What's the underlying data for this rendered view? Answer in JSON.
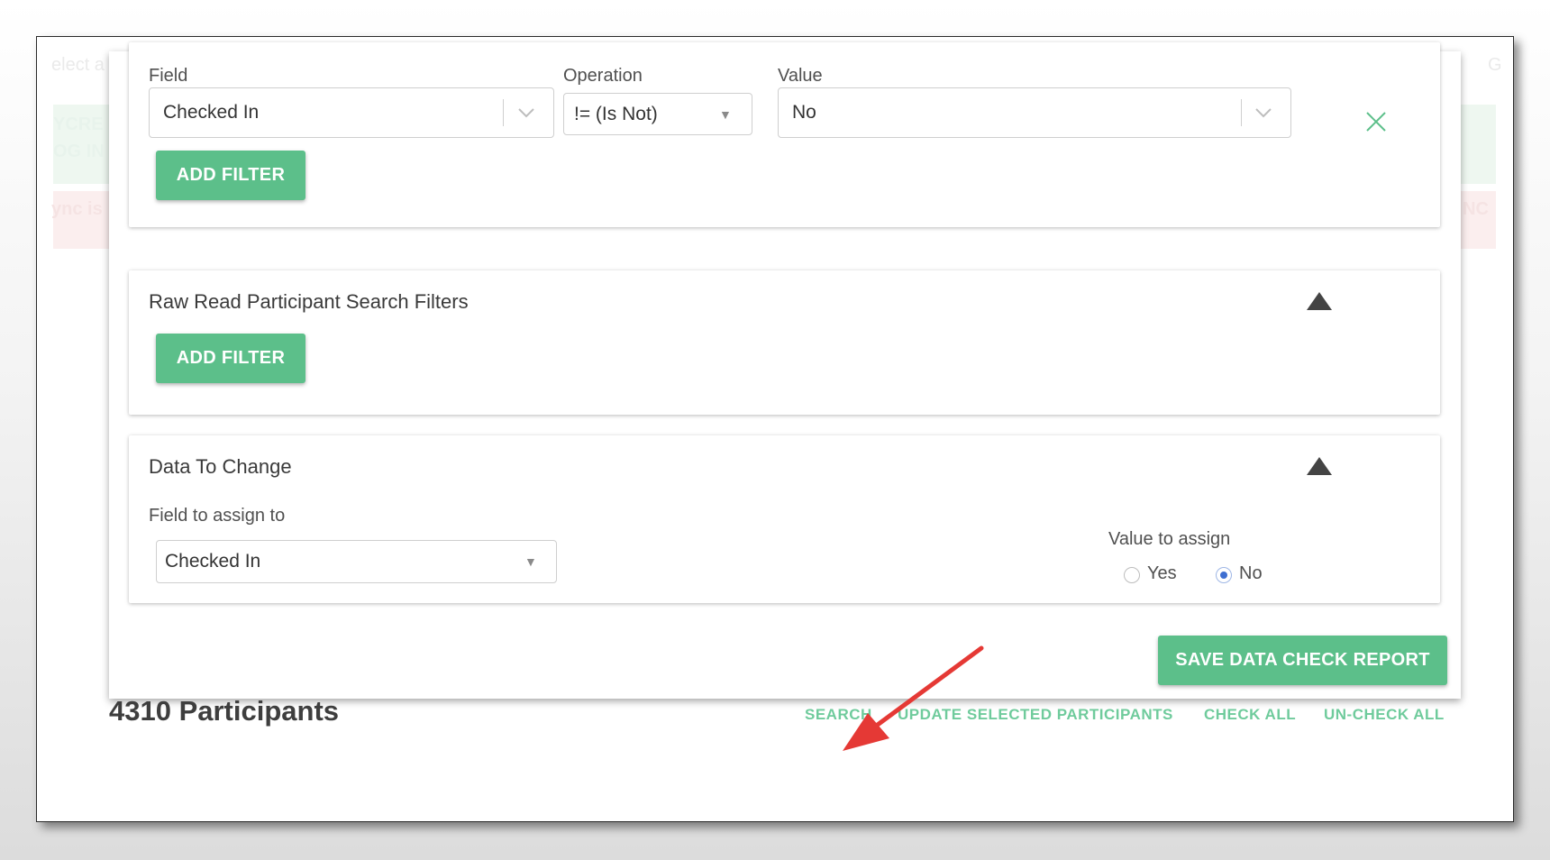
{
  "background": {
    "fragment_1": "elect a",
    "fragment_2": "YCRE",
    "fragment_3": "OG IN",
    "fragment_4": "ync is",
    "fragment_5": "G",
    "fragment_6": "NC"
  },
  "filter_row": {
    "field_label": "Field",
    "field_value": "Checked In",
    "operation_label": "Operation",
    "operation_value": "!= (Is Not)",
    "value_label": "Value",
    "value_value": "No",
    "add_filter_label": "ADD FILTER"
  },
  "raw_read_card": {
    "title": "Raw Read Participant Search Filters",
    "add_filter_label": "ADD FILTER"
  },
  "data_to_change": {
    "title": "Data To Change",
    "field_label": "Field to assign to",
    "field_value": "Checked In",
    "value_label": "Value to assign",
    "options": [
      "Yes",
      "No"
    ],
    "selected": "No"
  },
  "save_button_label": "SAVE DATA CHECK REPORT",
  "footer": {
    "participant_count": "4310 Participants",
    "links": {
      "search": "SEARCH",
      "update": "UPDATE SELECTED PARTICIPANTS",
      "check_all": "CHECK ALL",
      "uncheck_all": "UN-CHECK ALL"
    }
  },
  "colors": {
    "primary_green": "#5cbf8a",
    "link_green": "#6fcb9c",
    "annotation_red": "#e53935"
  }
}
